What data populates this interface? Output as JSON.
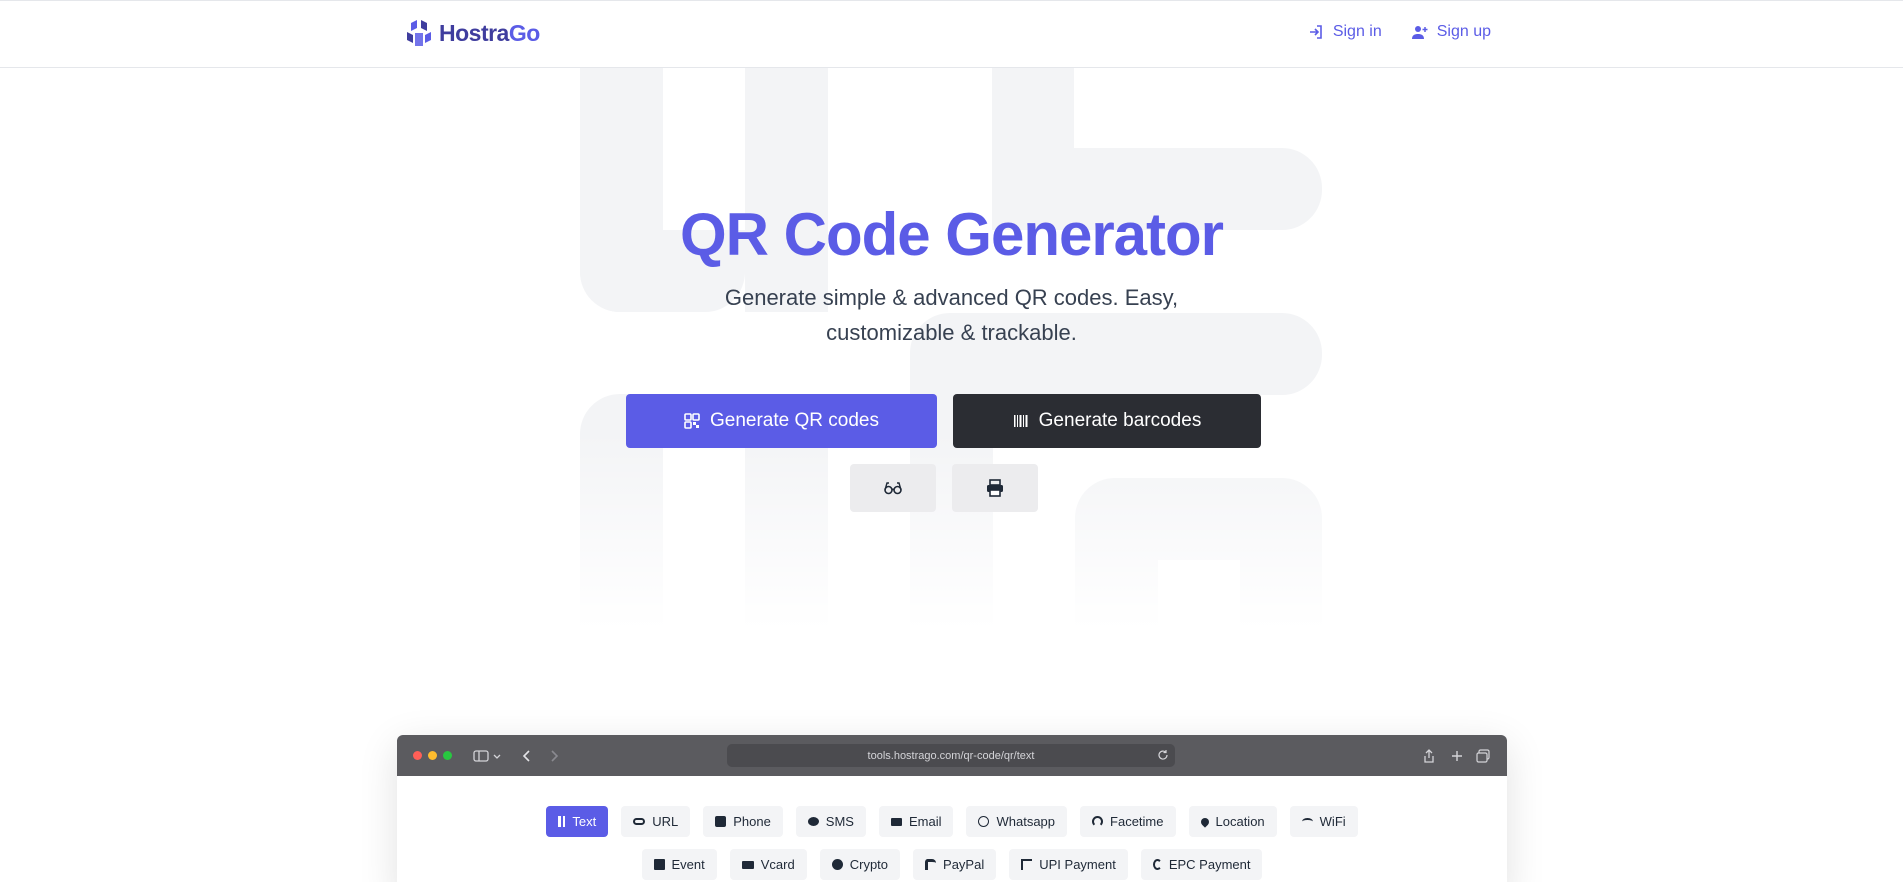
{
  "brand": {
    "name_part1": "Hostra",
    "name_part2": "Go",
    "accent": "#5b5ce6"
  },
  "nav": {
    "signin": "Sign in",
    "signup": "Sign up"
  },
  "hero": {
    "title": "QR Code Generator",
    "subtitle": "Generate simple & advanced QR codes. Easy, customizable & trackable.",
    "primary_button": "Generate QR codes",
    "secondary_button": "Generate barcodes",
    "icons": {
      "glasses": "glasses-icon",
      "print": "print-icon"
    }
  },
  "browser": {
    "url": "tools.hostrago.com/qr-code/qr/text",
    "tabs_row1": [
      "Text",
      "URL",
      "Phone",
      "SMS",
      "Email",
      "Whatsapp",
      "Facetime",
      "Location",
      "WiFi"
    ],
    "tabs_row2": [
      "Event",
      "Vcard",
      "Crypto",
      "PayPal",
      "UPI Payment",
      "EPC Payment"
    ],
    "active_tab": "Text"
  }
}
